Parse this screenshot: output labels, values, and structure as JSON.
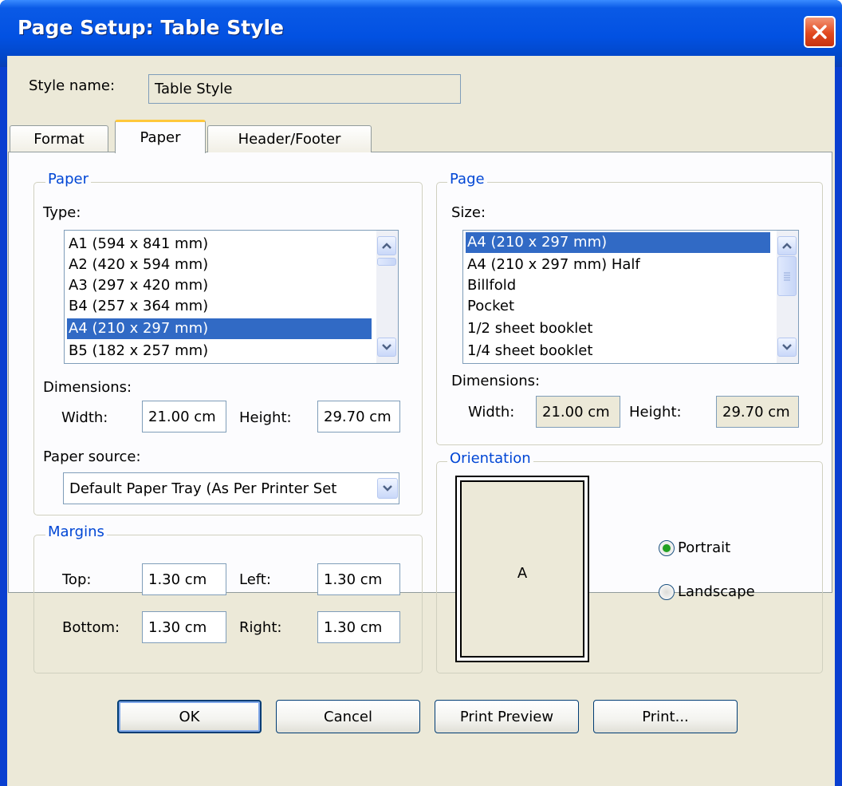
{
  "window": {
    "title": "Page Setup: Table Style",
    "close_icon": "close-icon",
    "close_color": "#e2491f"
  },
  "style_name": {
    "label": "Style name:",
    "value": "Table Style"
  },
  "tabs": [
    {
      "label": "Format"
    },
    {
      "label": "Paper",
      "active": true
    },
    {
      "label": "Header/Footer"
    }
  ],
  "paper_group": {
    "title": "Paper",
    "type_label": "Type:",
    "type_items": [
      "A1 (594 x 841 mm)",
      "A2 (420 x 594 mm)",
      "A3 (297 x 420 mm)",
      "B4 (257 x 364 mm)",
      "A4 (210 x 297 mm)",
      "B5 (182 x 257 mm)"
    ],
    "type_selected": "A4 (210 x 297 mm)",
    "dimensions_label": "Dimensions:",
    "width_label": "Width:",
    "width_value": "21.00 cm",
    "height_label": "Height:",
    "height_value": "29.70 cm",
    "source_label": "Paper source:",
    "source_value": "Default Paper Tray (As Per Printer Set"
  },
  "margins_group": {
    "title": "Margins",
    "top_label": "Top:",
    "top_value": "1.30 cm",
    "left_label": "Left:",
    "left_value": "1.30 cm",
    "bottom_label": "Bottom:",
    "bottom_value": "1.30 cm",
    "right_label": "Right:",
    "right_value": "1.30 cm"
  },
  "page_group": {
    "title": "Page",
    "size_label": "Size:",
    "size_items": [
      "A4 (210 x 297 mm)",
      "A4 (210 x 297 mm) Half",
      "Billfold",
      "Pocket",
      "1/2 sheet booklet",
      "1/4 sheet booklet"
    ],
    "size_selected": "A4 (210 x 297 mm)",
    "dimensions_label": "Dimensions:",
    "width_label": "Width:",
    "width_value": "21.00 cm",
    "height_label": "Height:",
    "height_value": "29.70 cm"
  },
  "orientation_group": {
    "title": "Orientation",
    "preview_letter": "A",
    "portrait_label": "Portrait",
    "landscape_label": "Landscape",
    "selected": "Portrait"
  },
  "buttons": {
    "ok": "OK",
    "cancel": "Cancel",
    "print_preview": "Print Preview",
    "print": "Print..."
  },
  "colors": {
    "selection": "#316ac5",
    "group_title": "#0046d5",
    "title_bar": "#0251e2",
    "radio_dot": "#21a121",
    "tab_highlight": "#ffc83c"
  }
}
